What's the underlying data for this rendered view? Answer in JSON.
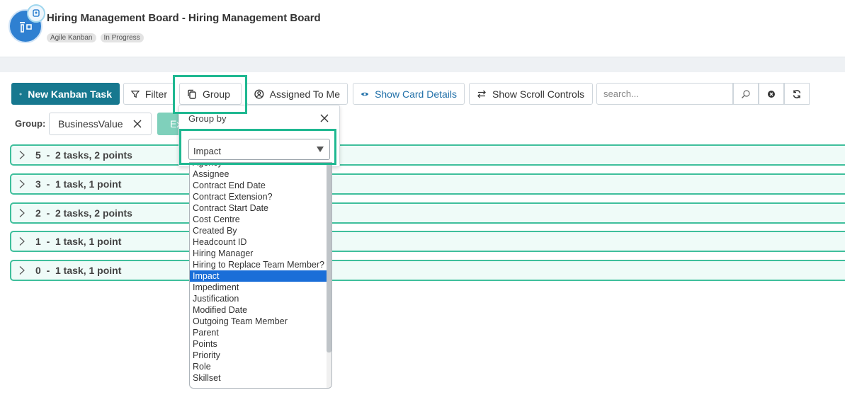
{
  "header": {
    "title": "Hiring Management Board - Hiring Management Board",
    "tags": [
      "Agile Kanban",
      "In Progress"
    ],
    "accent": "#2f80d1"
  },
  "toolbar": {
    "new_task": "New Kanban Task",
    "filter": "Filter",
    "group": "Group",
    "assigned": "Assigned To Me",
    "card_details": "Show Card Details",
    "scroll_controls": "Show Scroll Controls",
    "search_placeholder": "search...",
    "primary_color": "#17788f"
  },
  "group_row": {
    "label": "Group:",
    "value": "BusinessValue",
    "expand_button_partial": "Ex"
  },
  "lanes": [
    {
      "label": "5  -  2 tasks, 2 points"
    },
    {
      "label": "3  -  1 task, 1 point"
    },
    {
      "label": "2  -  2 tasks, 2 points"
    },
    {
      "label": "1  -  1 task, 1 point"
    },
    {
      "label": "0  -  1 task, 1 point"
    }
  ],
  "popup": {
    "title": "Group by",
    "selected": "Impact",
    "options": [
      "Agency",
      "Assignee",
      "Contract End Date",
      "Contract Extension?",
      "Contract Start Date",
      "Cost Centre",
      "Created By",
      "Headcount ID",
      "Hiring Manager",
      "Hiring to Replace Team Member?",
      "Impact",
      "Impediment",
      "Justification",
      "Modified Date",
      "Outgoing Team Member",
      "Parent",
      "Points",
      "Priority",
      "Role",
      "Skillset"
    ]
  },
  "highlight_color": "#1fb891"
}
